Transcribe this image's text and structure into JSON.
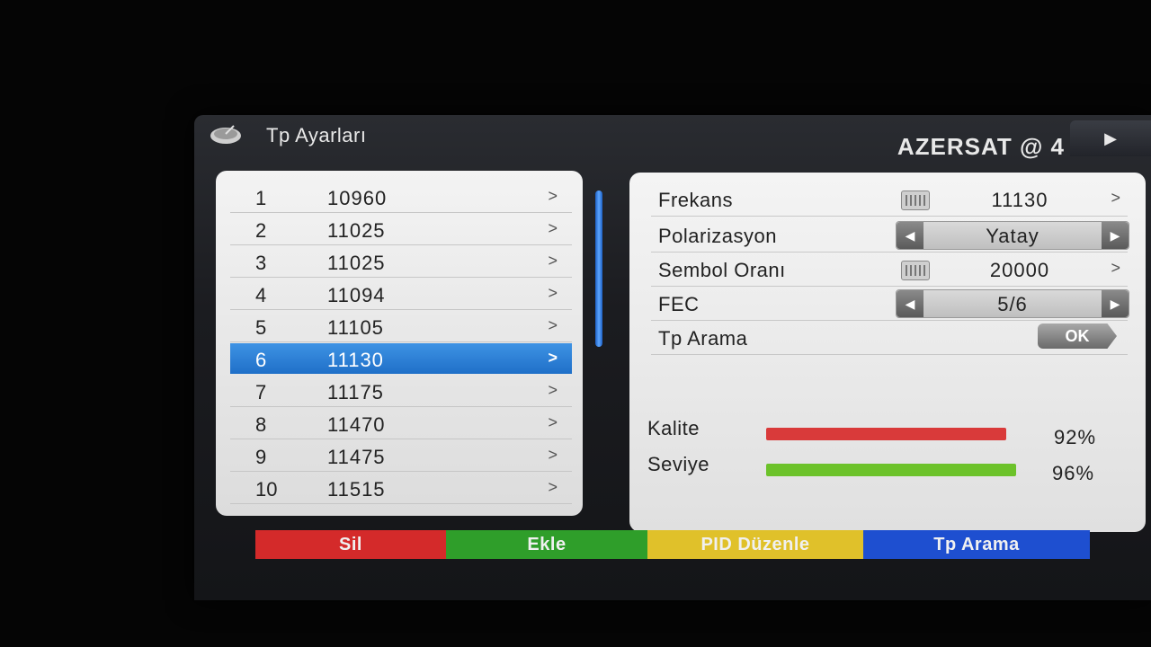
{
  "header": {
    "title": "Tp Ayarları",
    "satellite": "AZERSAT @ 4",
    "next_icon": "play-arrow-icon",
    "next_glyph": "▶"
  },
  "tp_list": {
    "chevron": ">",
    "selected_index": 5,
    "items": [
      {
        "num": "1",
        "freq": "10960"
      },
      {
        "num": "2",
        "freq": "11025"
      },
      {
        "num": "3",
        "freq": "11025"
      },
      {
        "num": "4",
        "freq": "11094"
      },
      {
        "num": "5",
        "freq": "11105"
      },
      {
        "num": "6",
        "freq": "11130"
      },
      {
        "num": "7",
        "freq": "11175"
      },
      {
        "num": "8",
        "freq": "11470"
      },
      {
        "num": "9",
        "freq": "11475"
      },
      {
        "num": "10",
        "freq": "11515"
      }
    ]
  },
  "details": {
    "frekans": {
      "label": "Frekans",
      "value": "11130",
      "icon": "keyboard-icon"
    },
    "polarizasyon": {
      "label": "Polarizasyon",
      "value": "Yatay"
    },
    "sembol": {
      "label": "Sembol Oranı",
      "value": "20000",
      "icon": "keyboard-icon"
    },
    "fec": {
      "label": "FEC",
      "value": "5/6"
    },
    "tp_arama": {
      "label": "Tp Arama",
      "button": "OK"
    },
    "chevron": ">",
    "left_arrow": "◀",
    "right_arrow": "▶"
  },
  "signal": {
    "kalite": {
      "label": "Kalite",
      "percent": "92%",
      "fraction": 0.92,
      "color": "#d93a3a"
    },
    "seviye": {
      "label": "Seviye",
      "percent": "96%",
      "fraction": 0.96,
      "color": "#6cc22a"
    }
  },
  "footer": {
    "buttons": [
      {
        "label": "Sil",
        "color": "#d42a2a"
      },
      {
        "label": "Ekle",
        "color": "#2f9e2a"
      },
      {
        "label": "PID Düzenle",
        "color": "#e0c12a"
      },
      {
        "label": "Tp Arama",
        "color": "#1e4fd0"
      }
    ]
  }
}
